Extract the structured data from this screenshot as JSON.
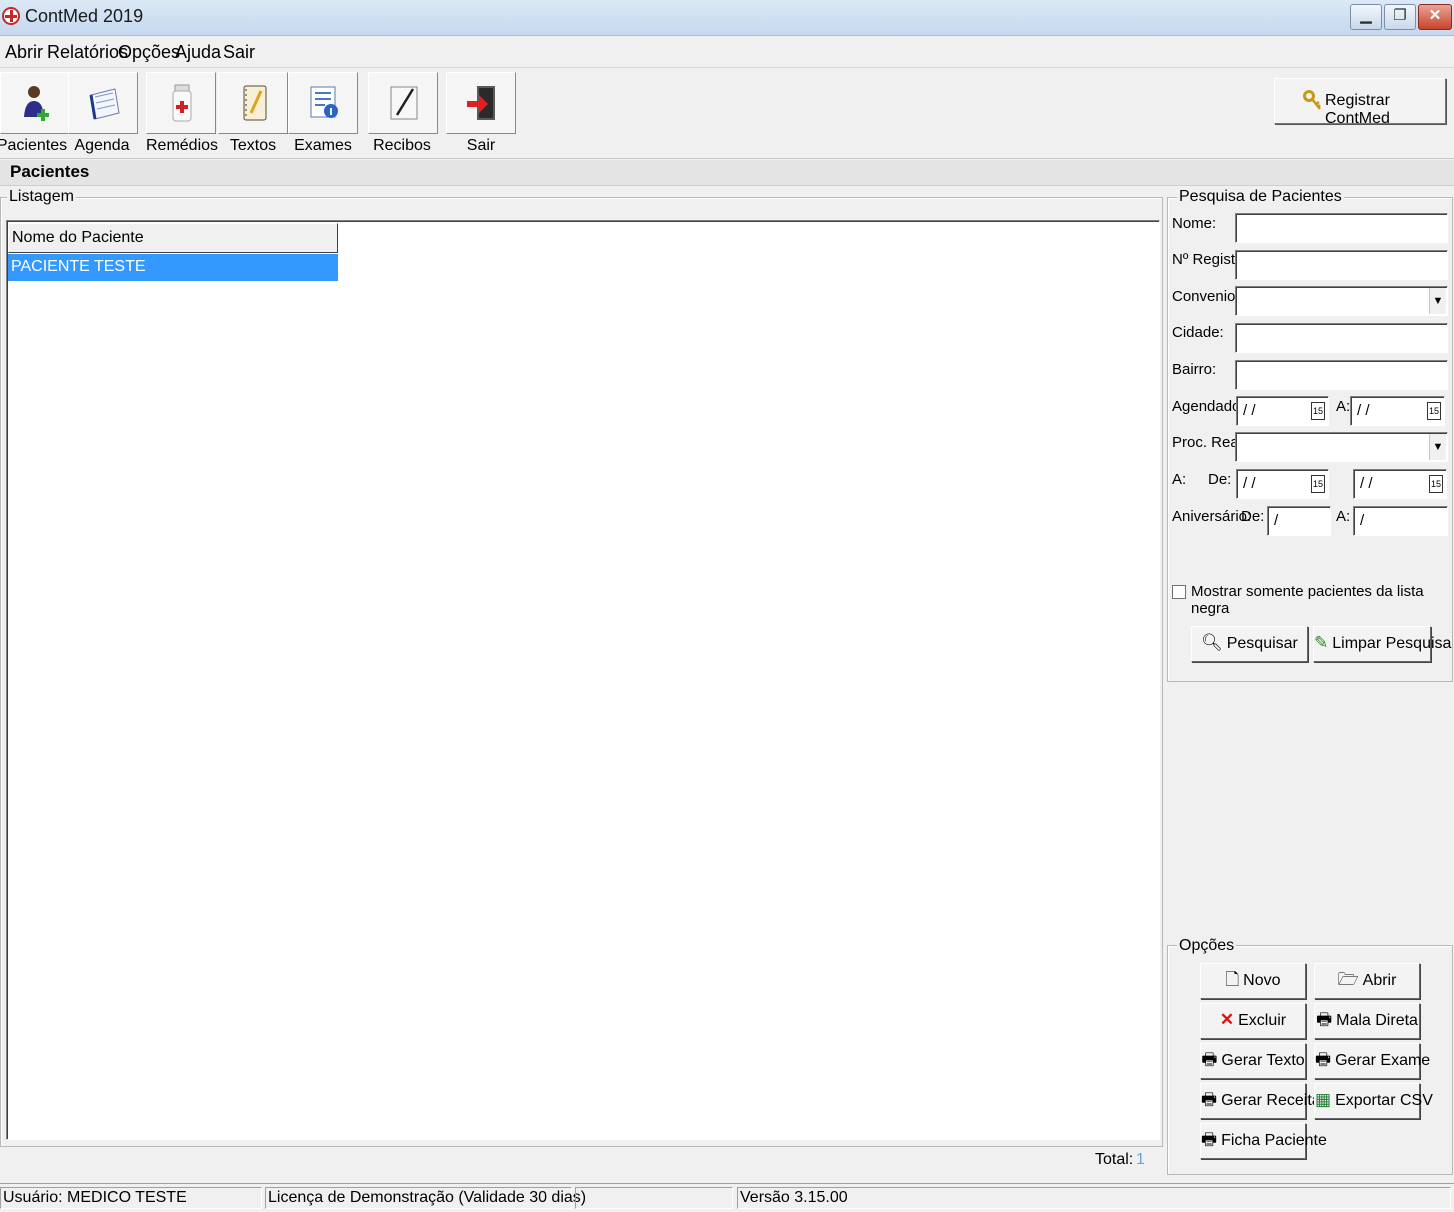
{
  "window": {
    "title": "ContMed 2019"
  },
  "menu": [
    "Abrir",
    "Relatórios",
    "Opções",
    "Ajuda",
    "Sair"
  ],
  "toolbar": {
    "buttons": [
      "Pacientes",
      "Agenda",
      "Remédios",
      "Textos",
      "Exames",
      "Recibos",
      "Sair"
    ],
    "register_label": "Registrar ContMed"
  },
  "section": {
    "title": "Pacientes"
  },
  "listing": {
    "legend": "Listagem",
    "column_header": "Nome do Paciente",
    "rows": [
      "PACIENTE TESTE"
    ],
    "total_label": "Total:",
    "total_value": "1"
  },
  "search": {
    "legend": "Pesquisa de Pacientes",
    "nome_label": "Nome:",
    "registro_label": "Nº Registro:",
    "convenio_label": "Convenio:",
    "cidade_label": "Cidade:",
    "bairro_label": "Bairro:",
    "agendado_label": "Agendado:",
    "a_label": "A:",
    "date_placeholder": "/ /",
    "proc_label": "Proc. Realiz.:",
    "a2_label": "A:",
    "de_label": "De:",
    "aniversario_label": "Aniversário:",
    "de2_label": "De:",
    "a3_label": "A:",
    "aniv_placeholder": "/",
    "checkbox_label": "Mostrar somente pacientes da lista negra",
    "search_button": "Pesquisar",
    "clear_button": "Limpar Pesquisa"
  },
  "options": {
    "legend": "Opções",
    "buttons": [
      "Novo",
      "Abrir",
      "Excluir",
      "Mala Direta",
      "Gerar Texto",
      "Gerar Exame",
      "Gerar Receita",
      "Exportar CSV",
      "Ficha Paciente"
    ]
  },
  "status": {
    "user": "Usuário: MEDICO TESTE",
    "license": "Licença de Demonstração (Validade 30 dias)",
    "empty": "",
    "version": "Versão 3.15.00"
  }
}
